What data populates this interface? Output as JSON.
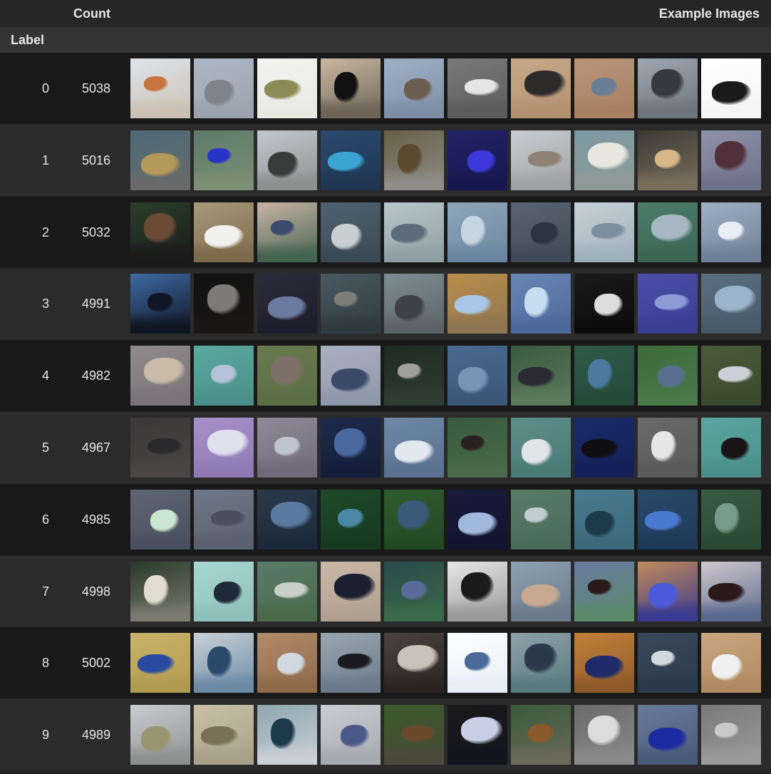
{
  "header": {
    "count_label": "Count",
    "examples_label": "Example Images",
    "label_label": "Label"
  },
  "rows": [
    {
      "label": "0",
      "count": "5038",
      "icon": "airplane-icon",
      "thumbs": [
        {
          "sky": "#dfe3ea",
          "obj": "#c8743e",
          "gnd": "#c9c2b4"
        },
        {
          "sky": "#aeb7c4",
          "obj": "#7d848d",
          "gnd": "#9aa3ae"
        },
        {
          "sky": "#f2f2ef",
          "obj": "#8c8a55",
          "gnd": "#e9e9e4"
        },
        {
          "sky": "#c9b8a0",
          "obj": "#111111",
          "gnd": "#6d6457"
        },
        {
          "sky": "#9fb0c6",
          "obj": "#6b5d4f",
          "gnd": "#7d8ea5"
        },
        {
          "sky": "#7a7a7a",
          "obj": "#e4e4e4",
          "gnd": "#5b5b5b"
        },
        {
          "sky": "#c7a98a",
          "obj": "#2d2b2a",
          "gnd": "#b29170"
        },
        {
          "sky": "#b99579",
          "obj": "#6a7e96",
          "gnd": "#a77f62"
        },
        {
          "sky": "#9fa6b0",
          "obj": "#363a40",
          "gnd": "#6f747a"
        },
        {
          "sky": "#ffffff",
          "obj": "#1a1a1a",
          "gnd": "#f5f5f5"
        }
      ]
    },
    {
      "label": "1",
      "count": "5016",
      "icon": "automobile-icon",
      "thumbs": [
        {
          "sky": "#4d6a78",
          "obj": "#b39a58",
          "gnd": "#6a6a6a"
        },
        {
          "sky": "#5c7b6a",
          "obj": "#2734c8",
          "gnd": "#7d8f74"
        },
        {
          "sky": "#c3c8cd",
          "obj": "#383c3a",
          "gnd": "#8d908f"
        },
        {
          "sky": "#2b4a6f",
          "obj": "#3aa5d3",
          "gnd": "#1f3552"
        },
        {
          "sky": "#676046",
          "obj": "#5a4a30",
          "gnd": "#8f8d8a"
        },
        {
          "sky": "#222266",
          "obj": "#3b39d9",
          "gnd": "#181850"
        },
        {
          "sky": "#c9ccd0",
          "obj": "#8d8173",
          "gnd": "#9fa1a3"
        },
        {
          "sky": "#7b9aa2",
          "obj": "#e8e8e0",
          "gnd": "#8f9a96"
        },
        {
          "sky": "#3c3a35",
          "obj": "#d6b888",
          "gnd": "#7a6e5c"
        },
        {
          "sky": "#8e91a8",
          "obj": "#50303a",
          "gnd": "#6f718a"
        }
      ]
    },
    {
      "label": "2",
      "count": "5032",
      "icon": "bird-icon",
      "thumbs": [
        {
          "sky": "#2b3f2a",
          "obj": "#6a4c36",
          "gnd": "#1a1a1a"
        },
        {
          "sky": "#a7997a",
          "obj": "#f0f0ee",
          "gnd": "#7d6a4a"
        },
        {
          "sky": "#c9b4a6",
          "obj": "#3c4a6e",
          "gnd": "#44634f"
        },
        {
          "sky": "#50616f",
          "obj": "#c9cfd0",
          "gnd": "#3a4a55"
        },
        {
          "sky": "#b8c6c8",
          "obj": "#5c6c7a",
          "gnd": "#8fa0a4"
        },
        {
          "sky": "#8ea6b8",
          "obj": "#c5d4e0",
          "gnd": "#6c86a0"
        },
        {
          "sky": "#5a6470",
          "obj": "#2c3442",
          "gnd": "#414a58"
        },
        {
          "sky": "#c6d0d6",
          "obj": "#7d8f9e",
          "gnd": "#9fb0bd"
        },
        {
          "sky": "#4a7d6a",
          "obj": "#a7b8c4",
          "gnd": "#3c6654"
        },
        {
          "sky": "#9fb0c6",
          "obj": "#e8eef4",
          "gnd": "#6f7f95"
        }
      ]
    },
    {
      "label": "3",
      "count": "4991",
      "icon": "cat-icon",
      "thumbs": [
        {
          "sky": "#3e6aa3",
          "obj": "#0f1625",
          "gnd": "#101522"
        },
        {
          "sky": "#111111",
          "obj": "#7d7b79",
          "gnd": "#191716"
        },
        {
          "sky": "#2c2b3a",
          "obj": "#6c7aa0",
          "gnd": "#1e1d2b"
        },
        {
          "sky": "#4a5a60",
          "obj": "#7d7d7a",
          "gnd": "#2f3a3f"
        },
        {
          "sky": "#7d8d90",
          "obj": "#3c4248",
          "gnd": "#5c6468"
        },
        {
          "sky": "#b88e4a",
          "obj": "#a9c6e6",
          "gnd": "#8d7550"
        },
        {
          "sky": "#6b86b5",
          "obj": "#c5ddee",
          "gnd": "#4c6799"
        },
        {
          "sky": "#1a1a1a",
          "obj": "#dcdcdc",
          "gnd": "#0c0c0c"
        },
        {
          "sky": "#4a4ea8",
          "obj": "#8d9ad6",
          "gnd": "#3a3e90"
        },
        {
          "sky": "#5a6f80",
          "obj": "#9cb4c9",
          "gnd": "#48596a"
        }
      ]
    },
    {
      "label": "4",
      "count": "4982",
      "icon": "deer-icon",
      "thumbs": [
        {
          "sky": "#8f8a8c",
          "obj": "#c9bba8",
          "gnd": "#7a7478"
        },
        {
          "sky": "#5aa8a0",
          "obj": "#b5c2d8",
          "gnd": "#4a9088"
        },
        {
          "sky": "#6a7a4f",
          "obj": "#7d7068",
          "gnd": "#5c6e44"
        },
        {
          "sky": "#aab0c0",
          "obj": "#3c4a6a",
          "gnd": "#8f97ab"
        },
        {
          "sky": "#1e2a22",
          "obj": "#9fa09a",
          "gnd": "#2f3c33"
        },
        {
          "sky": "#4a6a8f",
          "obj": "#7a94b5",
          "gnd": "#3c5677"
        },
        {
          "sky": "#3a5a3f",
          "obj": "#2a2a30",
          "gnd": "#5c7a5c"
        },
        {
          "sky": "#2f5a4a",
          "obj": "#4a7aa0",
          "gnd": "#244a3a"
        },
        {
          "sky": "#3e6a3a",
          "obj": "#5a6f8f",
          "gnd": "#4a7a4a"
        },
        {
          "sky": "#4a5a3a",
          "obj": "#c9d0d6",
          "gnd": "#3a4a2c"
        }
      ]
    },
    {
      "label": "5",
      "count": "4967",
      "icon": "dog-icon",
      "thumbs": [
        {
          "sky": "#3a3838",
          "obj": "#2a2a2c",
          "gnd": "#4a4646"
        },
        {
          "sky": "#a690c8",
          "obj": "#dfe0ee",
          "gnd": "#8f7ab5"
        },
        {
          "sky": "#8f8a98",
          "obj": "#c0c4d0",
          "gnd": "#6f6a7a"
        },
        {
          "sky": "#1e2a4a",
          "obj": "#4a6a9f",
          "gnd": "#141e3a"
        },
        {
          "sky": "#6f88a6",
          "obj": "#e2e8ef",
          "gnd": "#5a7090"
        },
        {
          "sky": "#3a5a3f",
          "obj": "#2a2020",
          "gnd": "#4a6a4a"
        },
        {
          "sky": "#5e8e8a",
          "obj": "#e0e4e6",
          "gnd": "#4a7a74"
        },
        {
          "sky": "#1a2a6a",
          "obj": "#0f0f12",
          "gnd": "#142058"
        },
        {
          "sky": "#6a6a6a",
          "obj": "#e6e6e6",
          "gnd": "#5a5a5a"
        },
        {
          "sky": "#5aa6a0",
          "obj": "#1a1414",
          "gnd": "#4a8f88"
        }
      ]
    },
    {
      "label": "6",
      "count": "4985",
      "icon": "frog-icon",
      "thumbs": [
        {
          "sky": "#5e6470",
          "obj": "#c9e6d0",
          "gnd": "#4a5060"
        },
        {
          "sky": "#6f7888",
          "obj": "#4a5060",
          "gnd": "#5a6070"
        },
        {
          "sky": "#2a3a4a",
          "obj": "#5a7aa0",
          "gnd": "#1a2a3a"
        },
        {
          "sky": "#1e4a2a",
          "obj": "#4a88a6",
          "gnd": "#163a20"
        },
        {
          "sky": "#2f5a2f",
          "obj": "#3a5a7a",
          "gnd": "#244a24"
        },
        {
          "sky": "#1a1a3a",
          "obj": "#9fb8dc",
          "gnd": "#141430"
        },
        {
          "sky": "#5a7a6a",
          "obj": "#c0ccd0",
          "gnd": "#4a6a5a"
        },
        {
          "sky": "#4a7a8f",
          "obj": "#1e3a4a",
          "gnd": "#3a6a7a"
        },
        {
          "sky": "#2a4a6a",
          "obj": "#4a7ad0",
          "gnd": "#1e3a58"
        },
        {
          "sky": "#3a5a44",
          "obj": "#7a9a88",
          "gnd": "#2a4a34"
        }
      ]
    },
    {
      "label": "7",
      "count": "4998",
      "icon": "horse-icon",
      "thumbs": [
        {
          "sky": "#2a3a2a",
          "obj": "#e0dcd0",
          "gnd": "#7a7a70"
        },
        {
          "sky": "#a6d6d0",
          "obj": "#1e2a3a",
          "gnd": "#8fc0ba"
        },
        {
          "sky": "#5a7a6a",
          "obj": "#c9d0c8",
          "gnd": "#4a6a4a"
        },
        {
          "sky": "#c9b8a6",
          "obj": "#1a2030",
          "gnd": "#b0a090"
        },
        {
          "sky": "#2a4a4a",
          "obj": "#5a6a9a",
          "gnd": "#3a6a4a"
        },
        {
          "sky": "#e6e6e6",
          "obj": "#1a1a1a",
          "gnd": "#9a9a9a"
        },
        {
          "sky": "#8fa0b0",
          "obj": "#c9a890",
          "gnd": "#6a7a8a"
        },
        {
          "sky": "#6a7aa0",
          "obj": "#2a1a1a",
          "gnd": "#5a8a6a"
        },
        {
          "sky": "#c08a5a",
          "obj": "#4a5ad8",
          "gnd": "#3a3a8f"
        },
        {
          "sky": "#d0c8cc",
          "obj": "#2a1a1a",
          "gnd": "#5a6a8f"
        }
      ]
    },
    {
      "label": "8",
      "count": "5002",
      "icon": "ship-icon",
      "thumbs": [
        {
          "sky": "#c9b46a",
          "obj": "#2a4aa0",
          "gnd": "#b09a50"
        },
        {
          "sky": "#c9d0d6",
          "obj": "#2a4a6a",
          "gnd": "#6a8aa6"
        },
        {
          "sky": "#b08a6a",
          "obj": "#d0d8e0",
          "gnd": "#8f6a4a"
        },
        {
          "sky": "#9aa6b0",
          "obj": "#1a1a20",
          "gnd": "#6a7a8a"
        },
        {
          "sky": "#4a4240",
          "obj": "#c9c0b8",
          "gnd": "#2a2422"
        },
        {
          "sky": "#ffffff",
          "obj": "#4a6a9a",
          "gnd": "#e6eef6"
        },
        {
          "sky": "#8fa0a8",
          "obj": "#2a3a4a",
          "gnd": "#5a7a80"
        },
        {
          "sky": "#c0803a",
          "obj": "#1e2a6a",
          "gnd": "#8f5a2a"
        },
        {
          "sky": "#3a4a5a",
          "obj": "#d0d8e0",
          "gnd": "#2a3a4a"
        },
        {
          "sky": "#c9a680",
          "obj": "#f0f0f0",
          "gnd": "#b08a60"
        }
      ]
    },
    {
      "label": "9",
      "count": "4989",
      "icon": "truck-icon",
      "thumbs": [
        {
          "sky": "#c9ccd0",
          "obj": "#9a9470",
          "gnd": "#8f9090"
        },
        {
          "sky": "#c9c0a8",
          "obj": "#7a7058",
          "gnd": "#a8a088"
        },
        {
          "sky": "#8fa6b0",
          "obj": "#1e3a4a",
          "gnd": "#c9d0d6"
        },
        {
          "sky": "#c9ccd0",
          "obj": "#4a5a8a",
          "gnd": "#a6aab0"
        },
        {
          "sky": "#3a5a2a",
          "obj": "#6a4a2a",
          "gnd": "#4a4a3a"
        },
        {
          "sky": "#1a1a1a",
          "obj": "#c9d0e6",
          "gnd": "#14141e"
        },
        {
          "sky": "#3a5a3a",
          "obj": "#8a5a2a",
          "gnd": "#6a6a5a"
        },
        {
          "sky": "#6a6a6a",
          "obj": "#dcdcdc",
          "gnd": "#8a8a8a"
        },
        {
          "sky": "#6a7a9a",
          "obj": "#1e2aa0",
          "gnd": "#4a5a7a"
        },
        {
          "sky": "#7a7a7a",
          "obj": "#c9c9c9",
          "gnd": "#9a9a9a"
        }
      ]
    }
  ]
}
